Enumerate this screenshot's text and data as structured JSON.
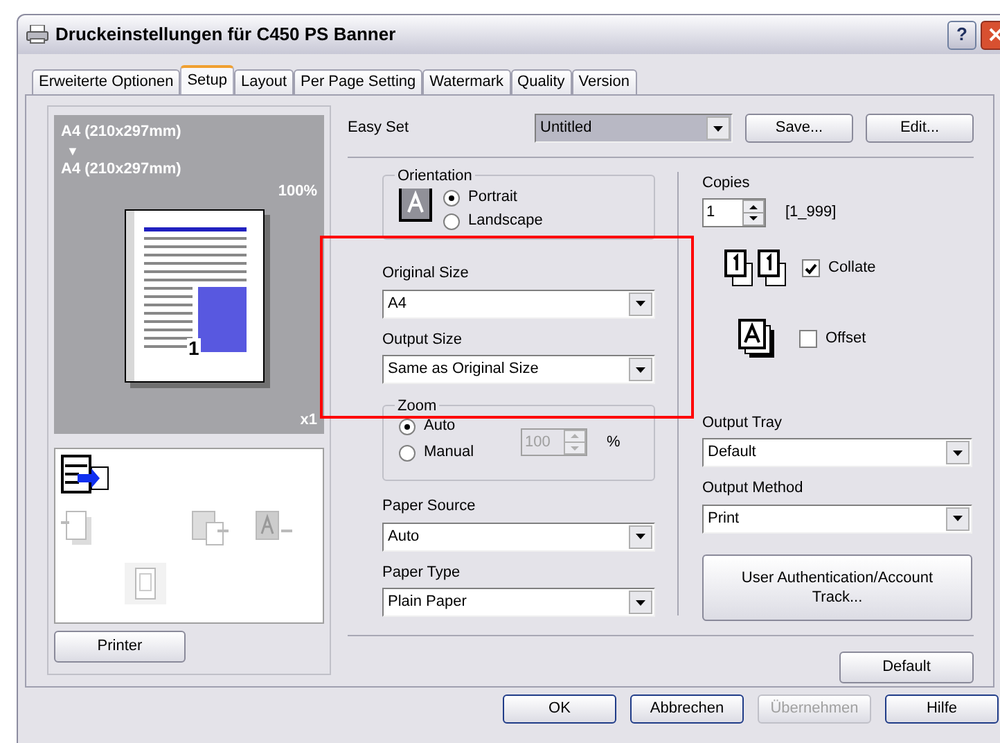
{
  "window": {
    "title": "Druckeinstellungen für C450 PS Banner",
    "help_button": "?"
  },
  "tabs": [
    {
      "label": "Erweiterte Optionen",
      "selected": false
    },
    {
      "label": "Setup",
      "selected": true
    },
    {
      "label": "Layout",
      "selected": false
    },
    {
      "label": "Per Page Setting",
      "selected": false
    },
    {
      "label": "Watermark",
      "selected": false
    },
    {
      "label": "Quality",
      "selected": false
    },
    {
      "label": "Version",
      "selected": false
    }
  ],
  "preview": {
    "original_size": "A4 (210x297mm)",
    "arrow": "▼",
    "output_size": "A4 (210x297mm)",
    "zoom": "100%",
    "page_number": "1",
    "copies": "x1"
  },
  "printer_button": "Printer",
  "easy_set": {
    "label": "Easy Set",
    "value": "Untitled",
    "buttons": [
      "Save...",
      "Edit..."
    ]
  },
  "orientation": {
    "legend": "Orientation",
    "options": [
      {
        "label": "Portrait",
        "selected": true
      },
      {
        "label": "Landscape",
        "selected": false
      }
    ]
  },
  "original_size": {
    "label": "Original Size",
    "value": "A4"
  },
  "output_size": {
    "label": "Output Size",
    "value": "Same as Original Size"
  },
  "zoom": {
    "legend": "Zoom",
    "options": [
      {
        "label": "Auto",
        "selected": true
      },
      {
        "label": "Manual",
        "selected": false
      }
    ],
    "value": "100",
    "disabled": true,
    "unit": "%"
  },
  "paper_source": {
    "label": "Paper Source",
    "value": "Auto"
  },
  "paper_type": {
    "label": "Paper Type",
    "value": "Plain Paper"
  },
  "copies": {
    "label": "Copies",
    "value": "1",
    "range": "[1_999]"
  },
  "collate": {
    "label": "Collate",
    "checked": true
  },
  "offset": {
    "label": "Offset",
    "checked": false
  },
  "output_tray": {
    "label": "Output Tray",
    "value": "Default"
  },
  "output_method": {
    "label": "Output Method",
    "value": "Print"
  },
  "auth_button": "User Authentication/Account Track...",
  "default_button": "Default",
  "dialog_buttons": [
    {
      "label": "OK",
      "disabled": false
    },
    {
      "label": "Abbrechen",
      "disabled": false
    },
    {
      "label": "Übernehmen",
      "disabled": true
    },
    {
      "label": "Hilfe",
      "disabled": false
    }
  ]
}
